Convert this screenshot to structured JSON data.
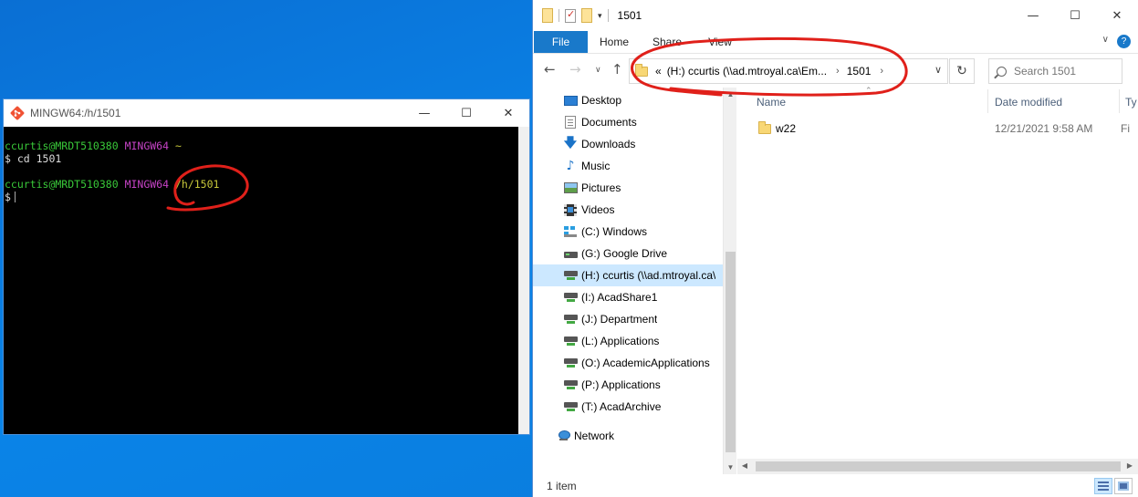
{
  "terminal": {
    "title": "MINGW64:/h/1501",
    "lines": {
      "l1_user": "ccurtis@MRDT510380",
      "l1_env": "MINGW64",
      "l1_path": "~",
      "l2": "$ cd 1501",
      "l3_user": "ccurtis@MRDT510380",
      "l3_env": "MINGW64",
      "l3_path": "/h/1501",
      "l4": "$"
    }
  },
  "explorer": {
    "title": "1501",
    "ribbon": {
      "file": "File",
      "home": "Home",
      "share": "Share",
      "view": "View"
    },
    "address": {
      "overflow": "«",
      "crumb1": "(H:) ccurtis (\\\\ad.mtroyal.ca\\Em...",
      "crumb2": "1501"
    },
    "search_placeholder": "Search 1501",
    "nav_items": [
      {
        "label": "Desktop"
      },
      {
        "label": "Documents"
      },
      {
        "label": "Downloads"
      },
      {
        "label": "Music"
      },
      {
        "label": "Pictures"
      },
      {
        "label": "Videos"
      },
      {
        "label": "(C:) Windows"
      },
      {
        "label": "(G:) Google Drive"
      },
      {
        "label": "(H:) ccurtis (\\\\ad.mtroyal.ca\\"
      },
      {
        "label": "(I:) AcadShare1"
      },
      {
        "label": "(J:) Department"
      },
      {
        "label": "(L:) Applications"
      },
      {
        "label": "(O:) AcademicApplications"
      },
      {
        "label": "(P:) Applications"
      },
      {
        "label": "(T:) AcadArchive"
      },
      {
        "label": "Network"
      }
    ],
    "columns": {
      "name": "Name",
      "date": "Date modified",
      "type": "Ty"
    },
    "files": [
      {
        "name": "w22",
        "date": "12/21/2021 9:58 AM",
        "type": "Fi"
      }
    ],
    "status": "1 item"
  }
}
